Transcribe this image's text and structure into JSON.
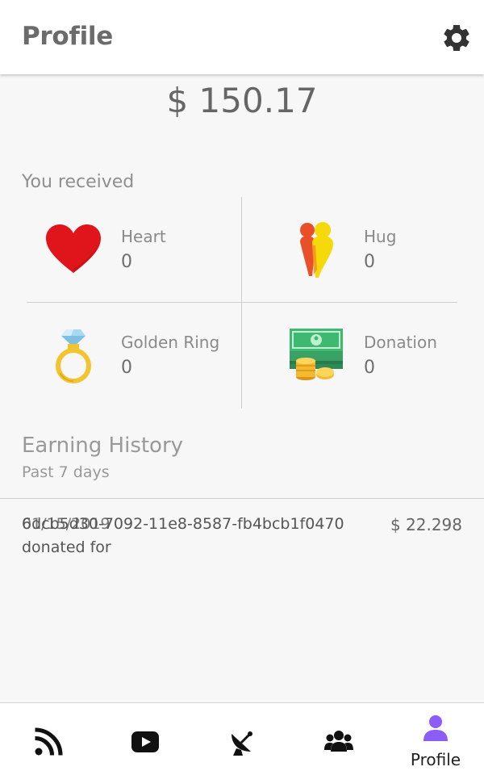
{
  "header": {
    "title": "Profile",
    "settings_icon": "gear-icon"
  },
  "balance": "$ 150.17",
  "received": {
    "label": "You received",
    "gifts": [
      {
        "name": "Heart",
        "count": "0",
        "icon": "heart-icon"
      },
      {
        "name": "Hug",
        "count": "0",
        "icon": "hug-icon"
      },
      {
        "name": "Golden Ring",
        "count": "0",
        "icon": "ring-icon"
      },
      {
        "name": "Donation",
        "count": "0",
        "icon": "money-icon"
      }
    ]
  },
  "history": {
    "title": "Earning History",
    "subtitle": "Past 7 days",
    "entries": [
      {
        "date": "01/15/2019",
        "id": "6dcb5d30-7092-11e8-8587-fb4bcb1f0470",
        "amount": "$ 22.298",
        "note": "donated for"
      }
    ]
  },
  "nav": {
    "items": [
      {
        "icon": "rss-feed-icon",
        "label": ""
      },
      {
        "icon": "youtube-icon",
        "label": ""
      },
      {
        "icon": "satellite-dish-icon",
        "label": ""
      },
      {
        "icon": "users-icon",
        "label": ""
      },
      {
        "icon": "user-icon",
        "label": "Profile",
        "active": true
      }
    ]
  },
  "colors": {
    "accent": "#8b5cf6",
    "heart": "#e0141b",
    "text_muted": "#8f8f8f"
  }
}
